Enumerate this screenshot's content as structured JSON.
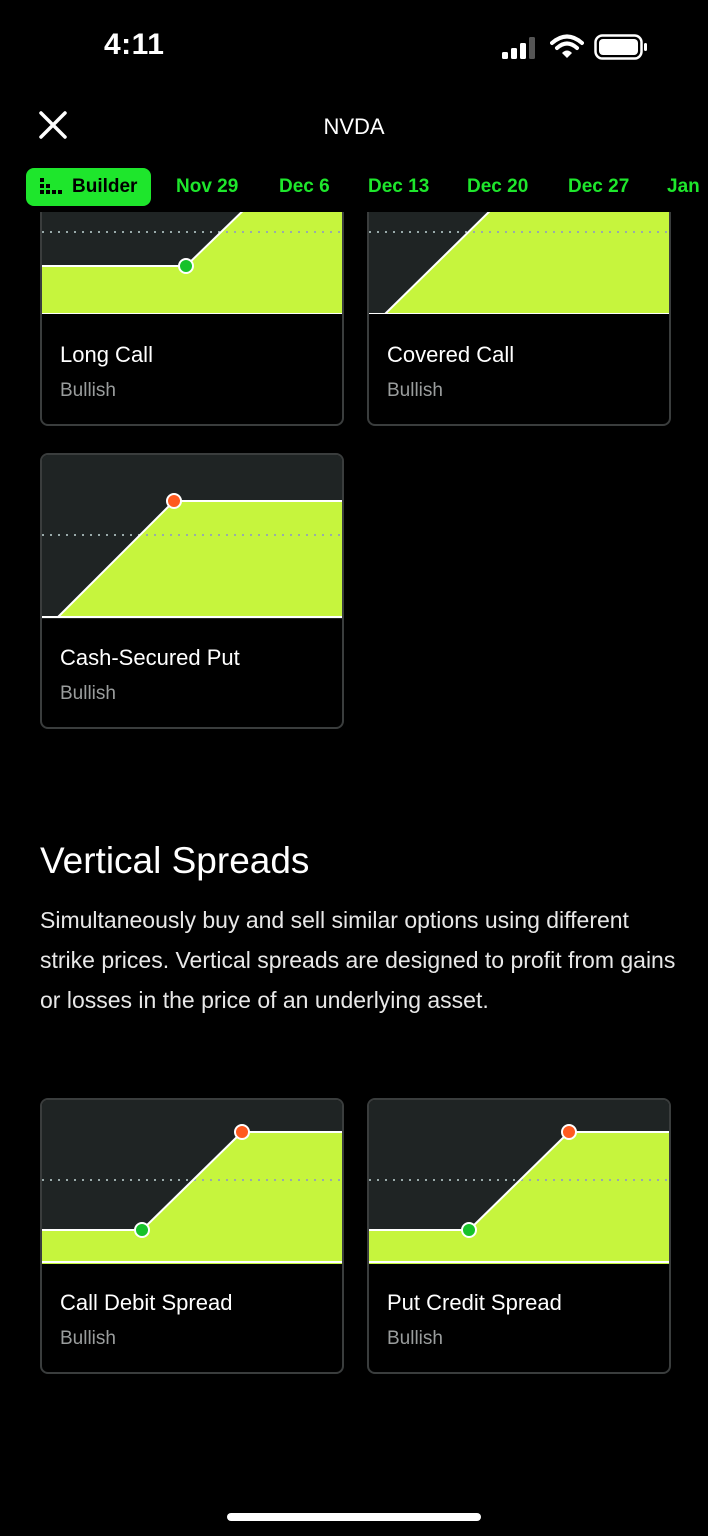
{
  "status_bar": {
    "time": "4:11"
  },
  "header": {
    "title": "NVDA",
    "close_icon": "close-icon"
  },
  "tabs": [
    {
      "label": "Builder",
      "active": true,
      "icon": "builder-icon"
    },
    {
      "label": "Nov 29"
    },
    {
      "label": "Dec 6"
    },
    {
      "label": "Dec 13"
    },
    {
      "label": "Dec 20"
    },
    {
      "label": "Dec 27"
    },
    {
      "label": "Jan"
    }
  ],
  "strategies_top": [
    {
      "name": "Long Call",
      "sentiment": "Bullish"
    },
    {
      "name": "Covered Call",
      "sentiment": "Bullish"
    },
    {
      "name": "Cash-Secured Put",
      "sentiment": "Bullish"
    }
  ],
  "vertical_spreads": {
    "title": "Vertical Spreads",
    "description": "Simultaneously buy and sell similar options using different strike prices. Vertical spreads are designed to profit from gains or losses in the price of an underlying asset.",
    "cards": [
      {
        "name": "Call Debit Spread",
        "sentiment": "Bullish"
      },
      {
        "name": "Put Credit Spread",
        "sentiment": "Bullish"
      }
    ]
  },
  "colors": {
    "accent_green": "#1ee62c",
    "payoff_fill": "#c6f53d",
    "chart_bg": "#1f2424",
    "marker_green": "#17c22a",
    "marker_orange": "#ff5a1f",
    "card_border": "#3a3d3d"
  }
}
